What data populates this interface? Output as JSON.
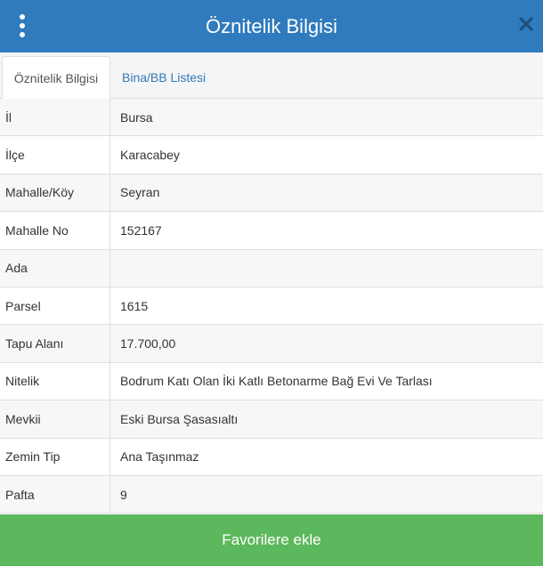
{
  "header": {
    "title": "Öznitelik Bilgisi",
    "menu_icon": "kebab-menu-icon",
    "close_icon": "close-icon"
  },
  "tabs": [
    {
      "label": "Öznitelik Bilgisi",
      "active": true
    },
    {
      "label": "Bina/BB Listesi",
      "active": false
    }
  ],
  "attributes": [
    {
      "key": "İl",
      "value": "Bursa"
    },
    {
      "key": "İlçe",
      "value": "Karacabey"
    },
    {
      "key": "Mahalle/Köy",
      "value": "Seyran"
    },
    {
      "key": "Mahalle No",
      "value": "152167"
    },
    {
      "key": "Ada",
      "value": ""
    },
    {
      "key": "Parsel",
      "value": "1615"
    },
    {
      "key": "Tapu Alanı",
      "value": "17.700,00"
    },
    {
      "key": "Nitelik",
      "value": "Bodrum Katı Olan İki Katlı Betonarme Bağ Evi Ve Tarlası"
    },
    {
      "key": "Mevkii",
      "value": "Eski Bursa Şasasıaltı"
    },
    {
      "key": "Zemin Tip",
      "value": "Ana Taşınmaz"
    },
    {
      "key": "Pafta",
      "value": "9"
    }
  ],
  "footer": {
    "favorite_label": "Favorilere ekle"
  },
  "colors": {
    "header_bg": "#2f7bbd",
    "tab_link": "#337ab7",
    "button_bg": "#5cb85c"
  }
}
